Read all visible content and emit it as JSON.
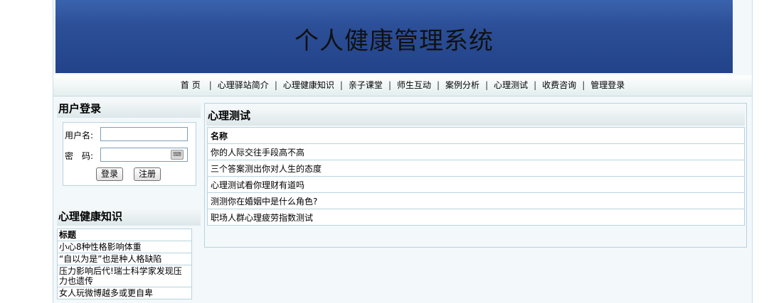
{
  "header": {
    "title": "个人健康管理系统"
  },
  "nav": {
    "items": [
      "首页",
      "心理驿站简介",
      "心理健康知识",
      "亲子课堂",
      "师生互动",
      "案例分析",
      "心理测试",
      "收费咨询",
      "管理登录"
    ],
    "separator": "|"
  },
  "login": {
    "title": "用户登录",
    "username_label": "用户名:",
    "username_value": "",
    "password_label": "密　码:",
    "password_value": "",
    "login_button": "登录",
    "register_button": "注册"
  },
  "knowledge": {
    "title": "心理健康知识",
    "column_header": "标题",
    "rows": [
      "小心8种性格影响体重",
      "“自以为是”也是种人格缺陷",
      "压力影响后代!瑞士科学家发现压力也遗传",
      "女人玩微博越多或更自卑"
    ]
  },
  "tests": {
    "title": "心理测试",
    "column_header": "名称",
    "rows": [
      "你的人际交往手段高不高",
      "三个答案测出你对人生的态度",
      "心理测试看你理财有道吗",
      "测测你在婚姻中是什么角色?",
      "职场人群心理疲劳指数测试"
    ]
  }
}
